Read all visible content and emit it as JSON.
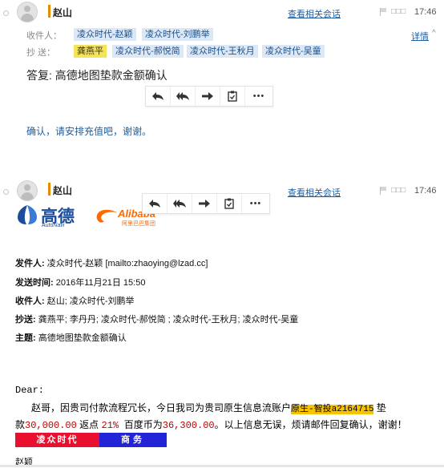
{
  "message1": {
    "sender": "赵山",
    "related_link": "查看相关会话",
    "status_text": "□□□",
    "time": "17:46",
    "details_link": "详情",
    "to_label": "收件人：",
    "to": [
      "凌众时代-赵颖",
      "凌众时代-刘鹏举"
    ],
    "cc_label": "抄  送：",
    "cc": [
      "龚燕平",
      "凌众时代-郝悦简",
      "凌众时代-王秋月",
      "凌众时代-吴童"
    ],
    "subject": "答复: 高德地图垫款金额确认",
    "body": "确认，请安排充值吧，谢谢。"
  },
  "toolbar": {
    "reply": "reply-icon",
    "reply_all": "reply-all-icon",
    "forward": "forward-icon",
    "notes": "clipboard-icon",
    "more": "•••"
  },
  "message2": {
    "sender": "赵山",
    "related_link": "查看相关会话",
    "status_text": "□□□",
    "time": "17:46",
    "logo_gaode": "高德",
    "logo_gaode_sub": "AutoNavi",
    "logo_alibaba": "Alibaba",
    "logo_alibaba_sub": "阿里巴巴集团",
    "from_label": "发件人:",
    "from_value": "凌众时代-赵颖 [mailto:zhaoying@lzad.cc]",
    "sent_label": "发送时间:",
    "sent_value": "2016年11月21日 15:50",
    "to_label": "收件人:",
    "to_value": "赵山; 凌众时代-刘鹏举",
    "cc_label": "抄送:",
    "cc_value": "龚燕平; 李丹丹; 凌众时代-郝悦简 ; 凌众时代-王秋月; 凌众时代-吴童",
    "subject_label": "主题:",
    "subject_value": "高德地图垫款金额确认",
    "greeting": "Dear:",
    "body_part1": "赵哥，因贵司付款流程冗长，今日我司为贵司原生信息流账户",
    "account_highlight": "原生-智投a2164715",
    "body_part2": " 垫",
    "body_line2_a": "款",
    "amount": "30,000.00",
    "rebate_label": " 返点 ",
    "rebate": "21%",
    "baidu_label": "  百度币为",
    "baidu_amount": "36,300.00",
    "body_line2_end": "。以上信息无误，烦请邮件回复确认，谢谢！",
    "sig_company": "凌众时代",
    "sig_dept": "商务",
    "sig_name": "赵颖"
  },
  "colors": {
    "link": "#1f5d9e",
    "chip_bg": "#dce8f5",
    "highlight": "#f7e35a",
    "sig_red": "#e8102e",
    "sig_blue": "#2323d8",
    "amount_red": "#c00000"
  }
}
